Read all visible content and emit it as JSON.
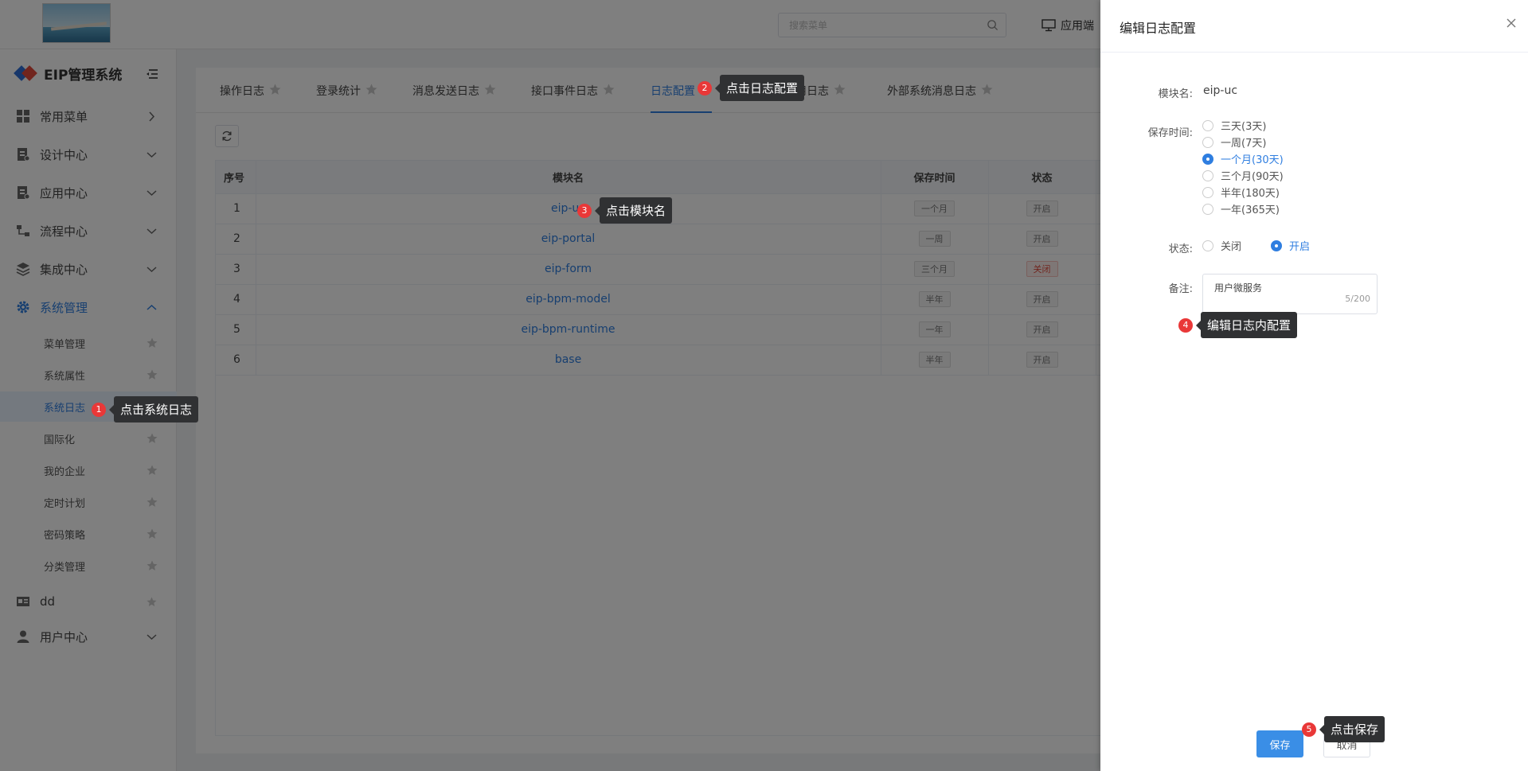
{
  "topbar": {
    "search_placeholder": "搜索菜单",
    "app_end_label": "应用端"
  },
  "sidebar": {
    "brand": "EIP管理系统",
    "groups": [
      {
        "label": "常用菜单",
        "icon": "grid-icon"
      },
      {
        "label": "设计中心",
        "icon": "design-icon"
      },
      {
        "label": "应用中心",
        "icon": "app-icon"
      },
      {
        "label": "流程中心",
        "icon": "flow-icon"
      },
      {
        "label": "集成中心",
        "icon": "layers-icon"
      },
      {
        "label": "系统管理",
        "icon": "gear-icon",
        "expanded": true
      }
    ],
    "sub_items": [
      {
        "label": "菜单管理"
      },
      {
        "label": "系统属性"
      },
      {
        "label": "系统日志",
        "active": true
      },
      {
        "label": "国际化"
      },
      {
        "label": "我的企业"
      },
      {
        "label": "定时计划"
      },
      {
        "label": "密码策略"
      },
      {
        "label": "分类管理"
      }
    ],
    "tail_items": [
      {
        "label": "dd",
        "icon": "card-icon"
      },
      {
        "label": "用户中心",
        "icon": "user-icon"
      }
    ]
  },
  "tabs": [
    {
      "label": "操作日志"
    },
    {
      "label": "登录统计"
    },
    {
      "label": "消息发送日志"
    },
    {
      "label": "接口事件日志"
    },
    {
      "label": "日志配置",
      "active": true
    },
    {
      "label": "用日志"
    },
    {
      "label": "外部系统消息日志"
    }
  ],
  "table": {
    "headers": {
      "idx": "序号",
      "module": "模块名",
      "retention": "保存时间",
      "status": "状态"
    },
    "rows": [
      {
        "idx": "1",
        "module": "eip-uc",
        "retention": "一个月",
        "status": "开启"
      },
      {
        "idx": "2",
        "module": "eip-portal",
        "retention": "一周",
        "status": "开启"
      },
      {
        "idx": "3",
        "module": "eip-form",
        "retention": "三个月",
        "status": "关闭"
      },
      {
        "idx": "4",
        "module": "eip-bpm-model",
        "retention": "半年",
        "status": "开启"
      },
      {
        "idx": "5",
        "module": "eip-bpm-runtime",
        "retention": "一年",
        "status": "开启"
      },
      {
        "idx": "6",
        "module": "base",
        "retention": "半年",
        "status": "开启"
      }
    ]
  },
  "drawer": {
    "title": "编辑日志配置",
    "module_label": "模块名:",
    "module_value": "eip-uc",
    "retention_label": "保存时间:",
    "retention_options": [
      {
        "label": "三天(3天)"
      },
      {
        "label": "一周(7天)"
      },
      {
        "label": "一个月(30天)",
        "checked": true
      },
      {
        "label": "三个月(90天)"
      },
      {
        "label": "半年(180天)"
      },
      {
        "label": "一年(365天)"
      }
    ],
    "status_label": "状态:",
    "status_off": "关闭",
    "status_on": "开启",
    "remark_label": "备注:",
    "remark_value": "用户微服务",
    "remark_count": "5/200",
    "save_label": "保存",
    "cancel_label": "取消"
  },
  "hints": [
    {
      "num": "1",
      "text": "点击系统日志"
    },
    {
      "num": "2",
      "text": "点击日志配置"
    },
    {
      "num": "3",
      "text": "点击模块名"
    },
    {
      "num": "4",
      "text": "编辑日志内配置"
    },
    {
      "num": "5",
      "text": "点击保存"
    }
  ],
  "colors": {
    "accent": "#2f7ee0",
    "danger": "#e93838",
    "tooltip": "#303133"
  }
}
